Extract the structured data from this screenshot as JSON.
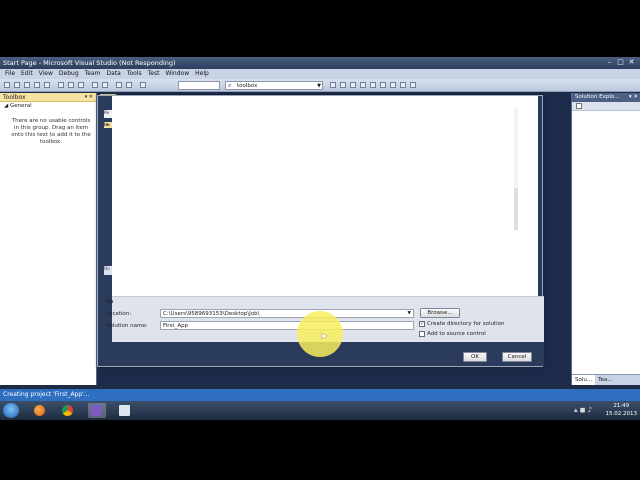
{
  "window": {
    "title": "Start Page - Microsoft Visual Studio (Not Responding)",
    "controls": [
      "–",
      "□",
      "✕"
    ]
  },
  "menu": [
    "File",
    "Edit",
    "View",
    "Debug",
    "Team",
    "Data",
    "Tools",
    "Test",
    "Window",
    "Help"
  ],
  "toolbar": {
    "find_value": "toolbox"
  },
  "toolbox": {
    "title": "Toolbox",
    "pin": "▾ ✕",
    "group": "◢ General",
    "message": "There are no usable controls in this group. Drag an item onto this text to add it to the toolbox."
  },
  "start_page": {
    "tab_label": "Re",
    "tab_label_2": "Im",
    "side_label": "On",
    "bottom_label": "Na"
  },
  "solution_explorer": {
    "title": "Solution Explo...",
    "close": "▾ ✕",
    "tabs": [
      "Solu...",
      "Tea..."
    ]
  },
  "dialog": {
    "location_label": "Location:",
    "location_value": "C:\\Users\\9589693153\\Desktop\\Job\\",
    "solution_name_label": "Solution name:",
    "solution_name_value": "First_App",
    "browse_label": "Browse...",
    "create_dir_label": "Create directory for solution",
    "create_dir_checked": "✓",
    "source_control_label": "Add to source control",
    "ok_label": "OK",
    "cancel_label": "Cancel"
  },
  "status": {
    "text": "Creating project 'First_App'..."
  },
  "taskbar": {
    "time": "21:49",
    "date": "15.02.2013"
  }
}
